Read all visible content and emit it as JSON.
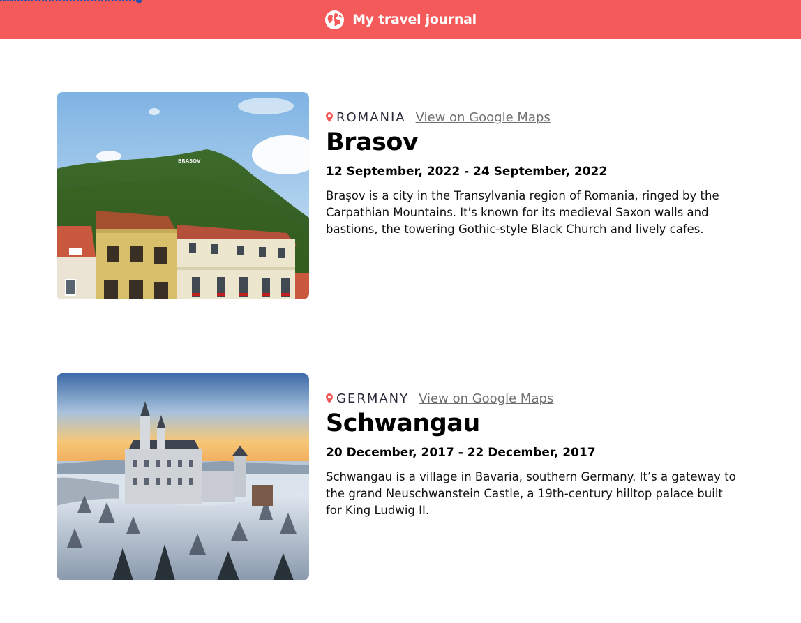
{
  "header": {
    "title": "My travel journal",
    "icon": "globe-icon",
    "background": "#F55A5A"
  },
  "entries": [
    {
      "country": "ROMANIA",
      "maps_link": "View on Google Maps",
      "place": "Brasov",
      "dates": "12 September, 2022 - 24 September, 2022",
      "description": "Brașov is a city in the Transylvania region of Romania, ringed by the Carpathian Mountains. It's known for its medieval Saxon walls and bastions, the towering Gothic-style Black Church and lively cafes.",
      "hillside_sign": "BRASOV"
    },
    {
      "country": "GERMANY",
      "maps_link": "View on Google Maps",
      "place": "Schwangau",
      "dates": "20 December, 2017 - 22 December, 2017",
      "description": "Schwangau is a village in Bavaria, southern Germany. It’s a gateway to the grand Neuschwanstein Castle, a 19th-century hilltop palace built for King Ludwig II."
    }
  ],
  "colors": {
    "accent": "#F55A5A",
    "link": "#707070",
    "text": "#2B283A"
  }
}
